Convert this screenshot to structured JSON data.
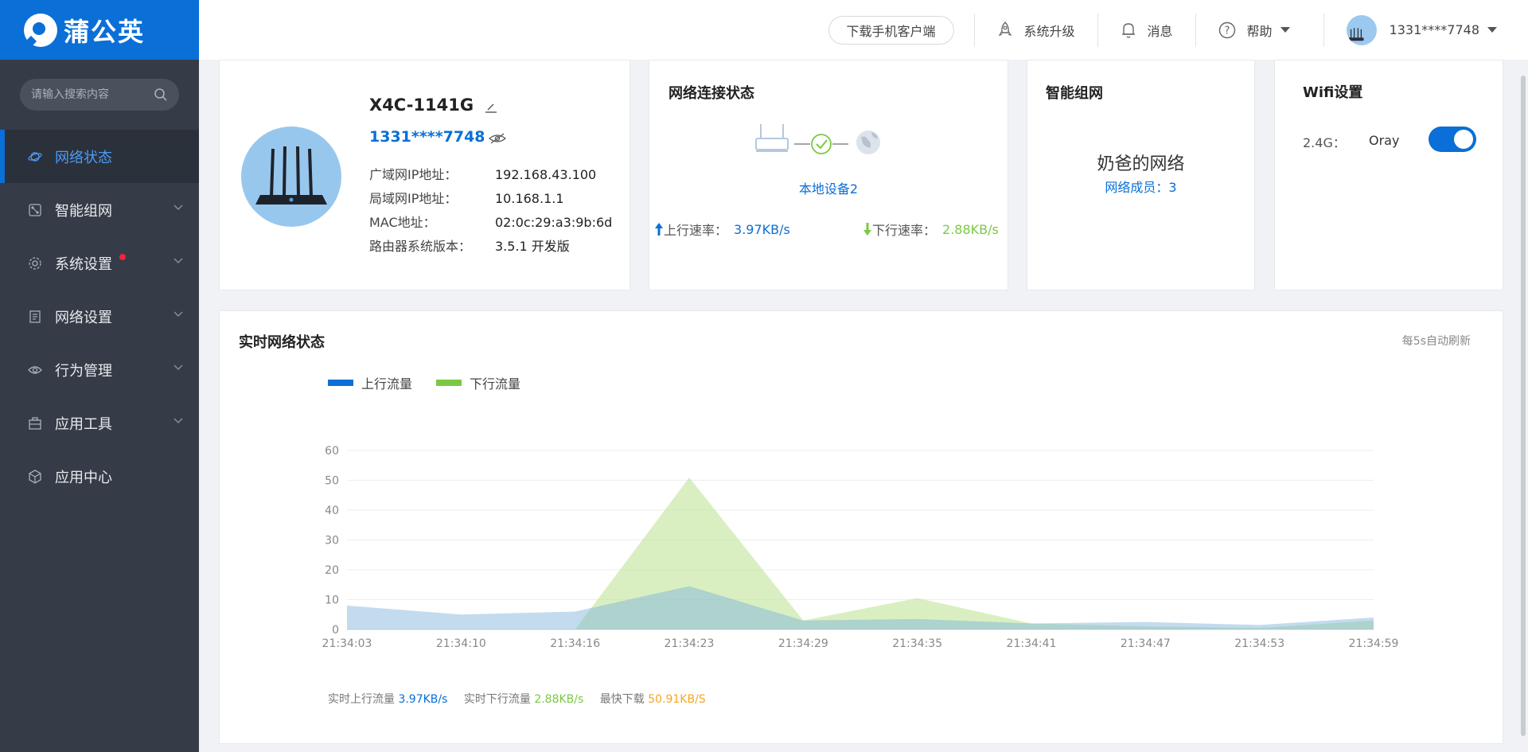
{
  "brand": {
    "name": "蒲公英"
  },
  "search": {
    "placeholder": "请输入搜索内容"
  },
  "sidebar": {
    "items": [
      {
        "label": "网络状态",
        "active": true
      },
      {
        "label": "智能组网",
        "has_submenu": true
      },
      {
        "label": "系统设置",
        "has_submenu": true,
        "badge": "dot"
      },
      {
        "label": "网络设置",
        "has_submenu": true
      },
      {
        "label": "行为管理",
        "has_submenu": true
      },
      {
        "label": "应用工具",
        "has_submenu": true
      },
      {
        "label": "应用中心"
      }
    ]
  },
  "topbar": {
    "download_label": "下载手机客户端",
    "upgrade_label": "系统升级",
    "messages_label": "消息",
    "help_label": "帮助",
    "user_label": "1331****7748"
  },
  "device": {
    "name": "X4C-1141G",
    "account": "1331****7748",
    "info": [
      {
        "label": "广域网IP地址：",
        "value": "192.168.43.100"
      },
      {
        "label": "局域网IP地址：",
        "value": "10.168.1.1"
      },
      {
        "label": "MAC地址：",
        "value": "02:0c:29:a3:9b:6d"
      },
      {
        "label": "路由器系统版本：",
        "value": "3.5.1 开发版"
      }
    ]
  },
  "network_status": {
    "title": "网络连接状态",
    "local_device": "本地设备2",
    "up_label": "上行速率：",
    "up_value": "3.97KB/s",
    "down_label": "下行速率：",
    "down_value": "2.88KB/s"
  },
  "mesh": {
    "title": "智能组网",
    "network_name": "奶爸的网络",
    "members": "网络成员：3"
  },
  "wifi": {
    "title": "Wifi设置",
    "band_label": "2.4G：",
    "ssid": "Oray",
    "enabled": true
  },
  "realtime": {
    "title": "实时网络状态",
    "refresh_note": "每5s自动刷新",
    "footer": {
      "up_label": "实时上行流量",
      "up_value": "3.97KB/s",
      "down_label": "实时下行流量",
      "down_value": "2.88KB/s",
      "peak_label": "最快下载",
      "peak_value": "50.91KB/S"
    }
  },
  "colors": {
    "brand_blue": "#0a6fd6",
    "sidebar_bg": "#353c48",
    "upload": "#0a6fd6",
    "download": "#7ac943",
    "peak": "#f5a623"
  },
  "chart_data": {
    "type": "area",
    "title": "",
    "xlabel": "",
    "ylabel": "",
    "ylim": [
      0,
      60
    ],
    "yticks": [
      0,
      10,
      20,
      30,
      40,
      50,
      60
    ],
    "x_ticks": [
      "21:34:03",
      "21:34:10",
      "21:34:16",
      "21:34:23",
      "21:34:29",
      "21:34:35",
      "21:34:41",
      "21:34:47",
      "21:34:53",
      "21:34:59"
    ],
    "grid": true,
    "legend_position": "top-left",
    "series": [
      {
        "name": "上行流量",
        "color": "#0a6fd6",
        "values": [
          8,
          5,
          6,
          14.5,
          3,
          3.5,
          2,
          2.5,
          1.5,
          4
        ]
      },
      {
        "name": "下行流量",
        "color": "#7ac943",
        "values": [
          0,
          0,
          0,
          50.91,
          3,
          10.5,
          2,
          1,
          0.5,
          3
        ]
      }
    ]
  }
}
